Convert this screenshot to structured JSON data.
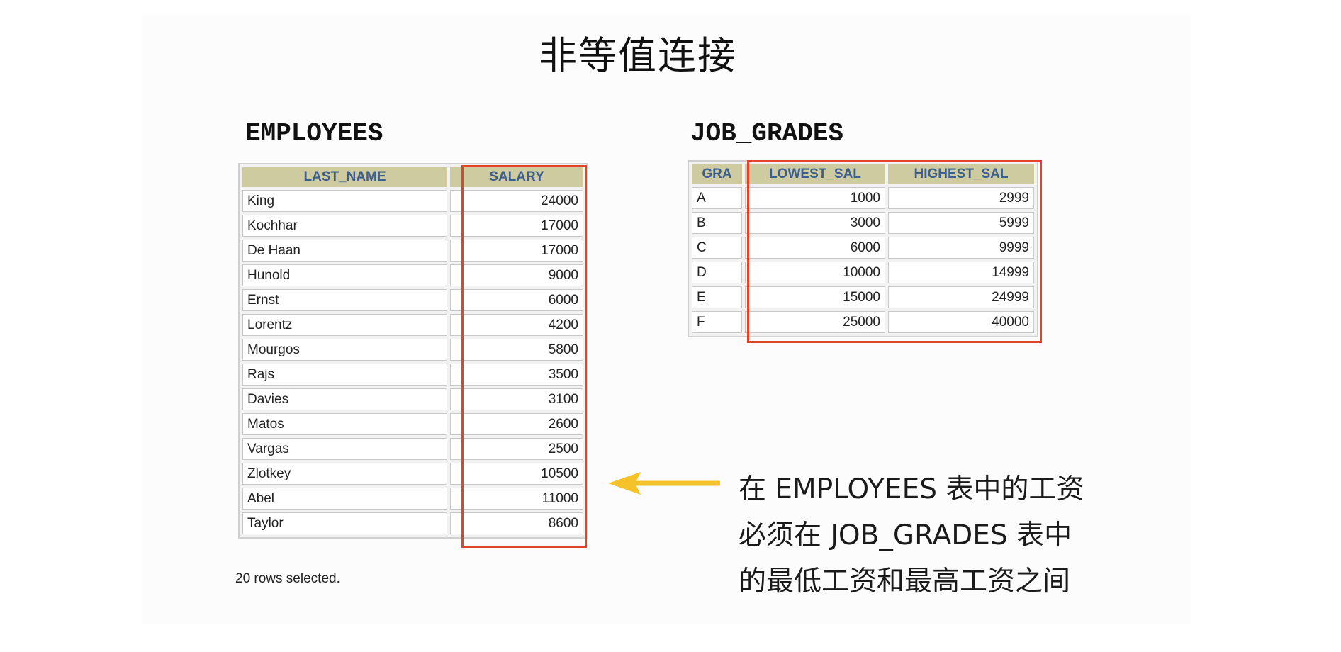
{
  "title": "非等值连接",
  "employees": {
    "title": "EMPLOYEES",
    "headers": [
      "LAST_NAME",
      "SALARY"
    ],
    "rows": [
      [
        "King",
        "24000"
      ],
      [
        "Kochhar",
        "17000"
      ],
      [
        "De Haan",
        "17000"
      ],
      [
        "Hunold",
        "9000"
      ],
      [
        "Ernst",
        "6000"
      ],
      [
        "Lorentz",
        "4200"
      ],
      [
        "Mourgos",
        "5800"
      ],
      [
        "Rajs",
        "3500"
      ],
      [
        "Davies",
        "3100"
      ],
      [
        "Matos",
        "2600"
      ],
      [
        "Vargas",
        "2500"
      ],
      [
        "Zlotkey",
        "10500"
      ],
      [
        "Abel",
        "11000"
      ],
      [
        "Taylor",
        "8600"
      ]
    ],
    "footer": "20 rows selected."
  },
  "job_grades": {
    "title": "JOB_GRADES",
    "headers": [
      "GRA",
      "LOWEST_SAL",
      "HIGHEST_SAL"
    ],
    "rows": [
      [
        "A",
        "1000",
        "2999"
      ],
      [
        "B",
        "3000",
        "5999"
      ],
      [
        "C",
        "6000",
        "9999"
      ],
      [
        "D",
        "10000",
        "14999"
      ],
      [
        "E",
        "15000",
        "24999"
      ],
      [
        "F",
        "25000",
        "40000"
      ]
    ]
  },
  "note": {
    "lines": [
      "在 EMPLOYEES 表中的工资",
      "必须在 JOB_GRADES 表中",
      "的最低工资和最高工资之间"
    ]
  },
  "colors": {
    "highlight": "#e0442a",
    "arrow": "#f5c22a",
    "header_bg": "#cfcba0",
    "header_text": "#3b5e8f"
  }
}
